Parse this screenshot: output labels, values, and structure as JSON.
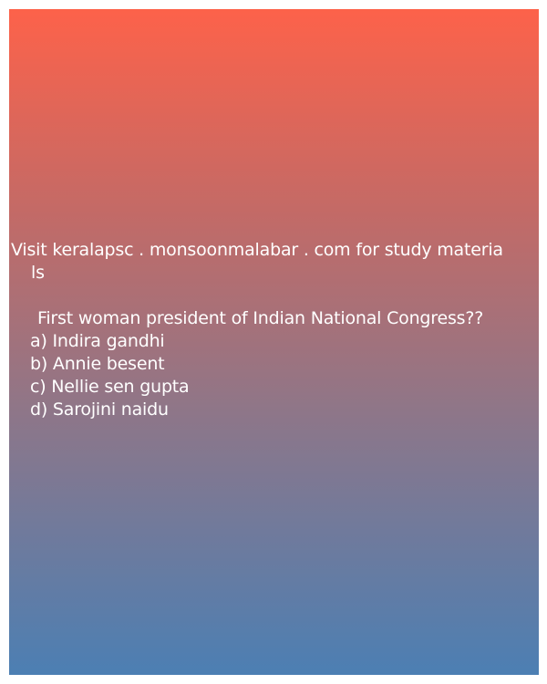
{
  "promo": {
    "line1": "Visit keralapsc . monsoonmalabar . com for study materia",
    "line2": "ls"
  },
  "quiz": {
    "question": "First woman president of Indian National Congress??",
    "options": [
      "a) Indira gandhi",
      "b) Annie besent",
      "c) Nellie sen gupta",
      "d) Sarojini naidu"
    ]
  },
  "colors": {
    "gradient_top": "#fd624a",
    "gradient_bottom": "#4c7fb3",
    "text": "#ffffff"
  }
}
